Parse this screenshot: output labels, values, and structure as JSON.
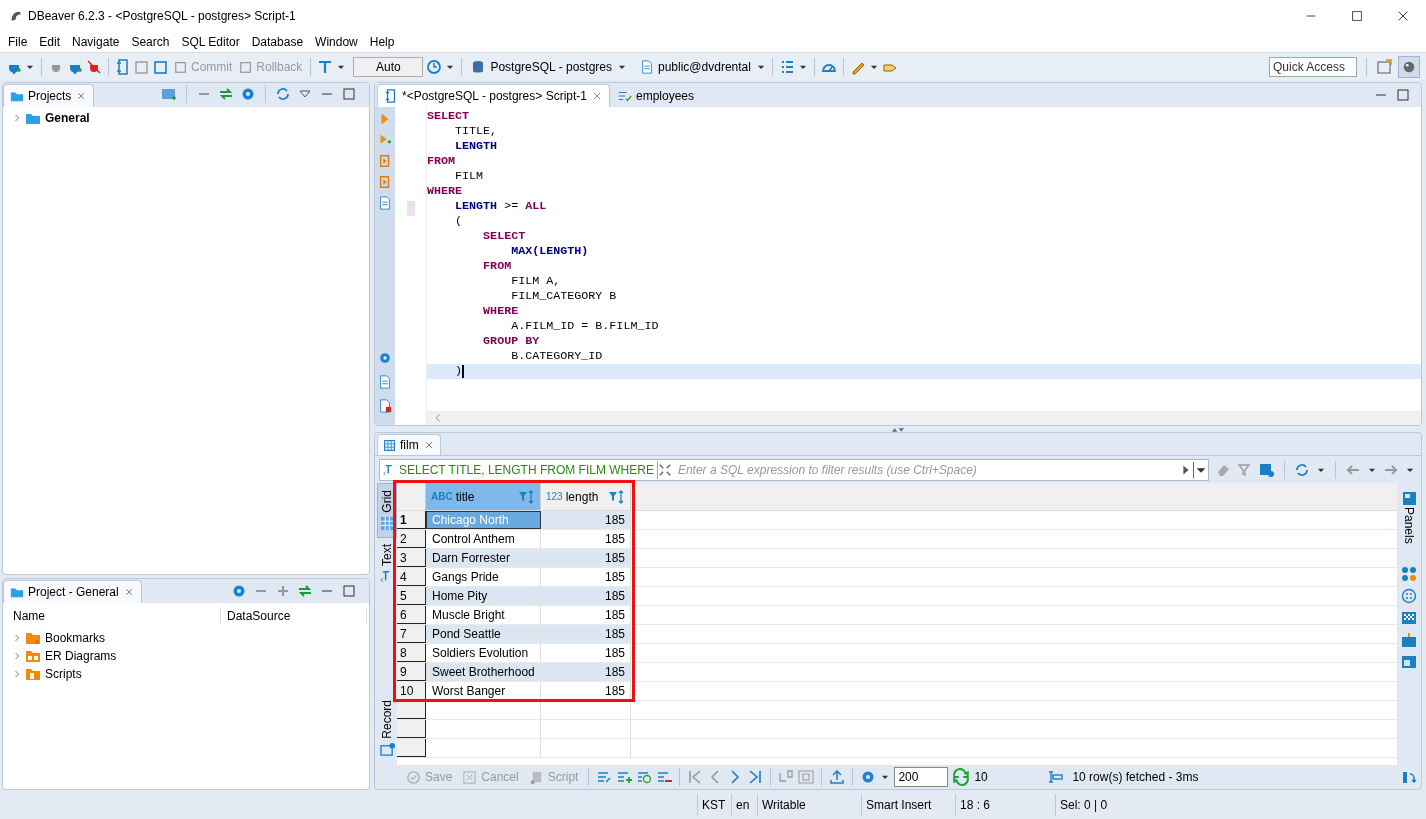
{
  "window": {
    "title": "DBeaver 6.2.3 - <PostgreSQL - postgres> Script-1"
  },
  "menu": [
    "File",
    "Edit",
    "Navigate",
    "Search",
    "SQL Editor",
    "Database",
    "Window",
    "Help"
  ],
  "toolbar": {
    "commit": {
      "label": "Commit",
      "disabled": true
    },
    "rollback": {
      "label": "Rollback",
      "disabled": true
    },
    "mode": "Auto",
    "connection": "PostgreSQL - postgres",
    "schema": "public@dvdrental",
    "quick_access": "Quick Access"
  },
  "projects_panel": {
    "tab": "Projects",
    "tree": [
      {
        "label": "General",
        "expanded": false
      }
    ]
  },
  "project_general_panel": {
    "tab": "Project - General",
    "columns": [
      "Name",
      "DataSource"
    ],
    "items": [
      {
        "label": "Bookmarks",
        "kind": "bookmarks",
        "expanded": false
      },
      {
        "label": "ER Diagrams",
        "kind": "diagrams",
        "expanded": false
      },
      {
        "label": "Scripts",
        "kind": "scripts",
        "expanded": false
      }
    ]
  },
  "editor_tabs": [
    {
      "label": "*<PostgreSQL - postgres> Script-1",
      "selected": true
    },
    {
      "label": "employees",
      "selected": false
    }
  ],
  "sql_lines": [
    {
      "tokens": [
        {
          "kind": "keyword",
          "text": "SELECT"
        }
      ],
      "current": false
    },
    {
      "tokens": [
        {
          "kind": "plain",
          "text": "    TITLE,"
        }
      ],
      "current": false
    },
    {
      "tokens": [
        {
          "kind": "column",
          "text": "    LENGTH"
        }
      ],
      "current": false
    },
    {
      "tokens": [
        {
          "kind": "keyword",
          "text": "FROM"
        }
      ],
      "current": false
    },
    {
      "tokens": [
        {
          "kind": "plain",
          "text": "    FILM"
        }
      ],
      "current": false
    },
    {
      "tokens": [
        {
          "kind": "keyword",
          "text": "WHERE"
        }
      ],
      "current": false
    },
    {
      "tokens": [
        {
          "kind": "column",
          "text": "    LENGTH"
        },
        {
          "kind": "plain",
          "text": " >= "
        },
        {
          "kind": "keyword",
          "text": "ALL"
        }
      ],
      "current": false
    },
    {
      "tokens": [
        {
          "kind": "plain",
          "text": "    ("
        }
      ],
      "current": false
    },
    {
      "tokens": [
        {
          "kind": "keyword",
          "text": "        SELECT"
        }
      ],
      "current": false
    },
    {
      "tokens": [
        {
          "kind": "column",
          "text": "            MAX(LENGTH)"
        }
      ],
      "current": false
    },
    {
      "tokens": [
        {
          "kind": "keyword",
          "text": "        FROM"
        }
      ],
      "current": false
    },
    {
      "tokens": [
        {
          "kind": "plain",
          "text": "            FILM A,"
        }
      ],
      "current": false
    },
    {
      "tokens": [
        {
          "kind": "plain",
          "text": "            FILM_CATEGORY B"
        }
      ],
      "current": false
    },
    {
      "tokens": [
        {
          "kind": "keyword",
          "text": "        WHERE"
        }
      ],
      "current": false
    },
    {
      "tokens": [
        {
          "kind": "plain",
          "text": "            A.FILM_ID = B.FILM_ID"
        }
      ],
      "current": false
    },
    {
      "tokens": [
        {
          "kind": "keyword",
          "text": "        GROUP BY"
        }
      ],
      "current": false
    },
    {
      "tokens": [
        {
          "kind": "plain",
          "text": "            B.CATEGORY_ID"
        }
      ],
      "current": false
    },
    {
      "tokens": [
        {
          "kind": "plain",
          "text": "    )"
        }
      ],
      "current": true
    }
  ],
  "results": {
    "tab": "film",
    "query": "SELECT TITLE, LENGTH FROM FILM WHERE",
    "filter_placeholder": "Enter a SQL expression to filter results (use Ctrl+Space)",
    "view_tabs": [
      {
        "label": "Grid",
        "selected": true
      },
      {
        "label": "Text",
        "selected": false
      },
      {
        "label": "Record",
        "selected": false
      }
    ],
    "panels_label": "Panels",
    "highlighted": true,
    "columns": [
      {
        "type_label": "ABC",
        "name": "title",
        "selected": true
      },
      {
        "type_label": "123",
        "name": "length",
        "selected": false
      }
    ],
    "rows": [
      {
        "num": "1",
        "title": "Chicago North",
        "length": "185",
        "selected": true
      },
      {
        "num": "2",
        "title": "Control Anthem",
        "length": "185",
        "selected": false
      },
      {
        "num": "3",
        "title": "Darn Forrester",
        "length": "185",
        "selected": false
      },
      {
        "num": "4",
        "title": "Gangs Pride",
        "length": "185",
        "selected": false
      },
      {
        "num": "5",
        "title": "Home Pity",
        "length": "185",
        "selected": false
      },
      {
        "num": "6",
        "title": "Muscle Bright",
        "length": "185",
        "selected": false
      },
      {
        "num": "7",
        "title": "Pond Seattle",
        "length": "185",
        "selected": false
      },
      {
        "num": "8",
        "title": "Soldiers Evolution",
        "length": "185",
        "selected": false
      },
      {
        "num": "9",
        "title": "Sweet Brotherhood",
        "length": "185",
        "selected": false
      },
      {
        "num": "10",
        "title": "Worst Banger",
        "length": "185",
        "selected": false
      }
    ],
    "bottom": {
      "save": {
        "label": "Save",
        "disabled": true
      },
      "cancel": {
        "label": "Cancel",
        "disabled": true
      },
      "script": {
        "label": "Script",
        "disabled": true
      },
      "fetch_size": "200",
      "row_count": "10",
      "status": "10 row(s) fetched - 3ms"
    }
  },
  "status_bar": [
    "KST",
    "en",
    "Writable",
    "Smart Insert",
    "18 : 6",
    "Sel: 0 | 0"
  ]
}
